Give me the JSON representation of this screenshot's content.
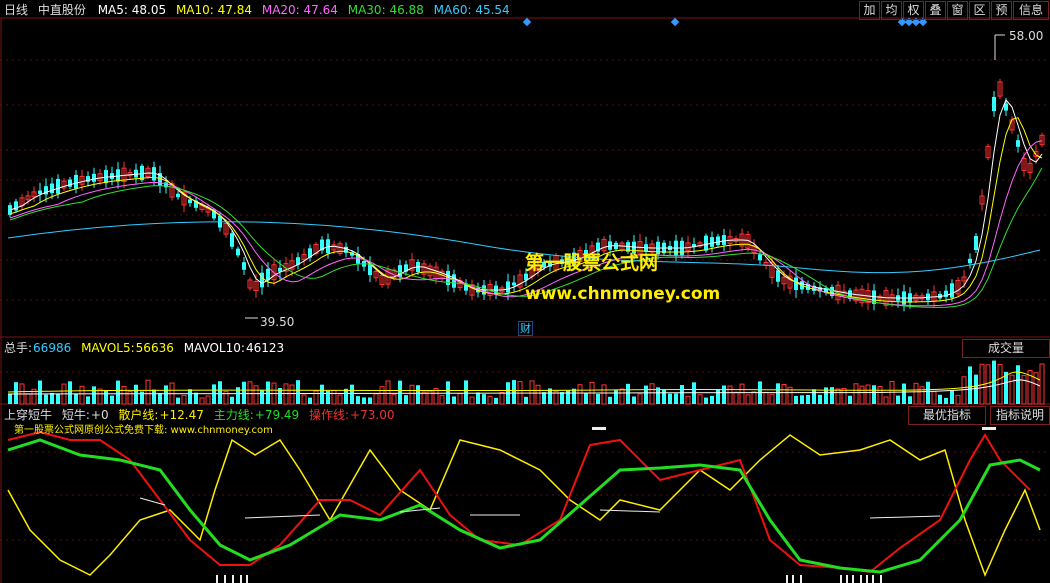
{
  "header": {
    "period": "日线",
    "stock": "中直股份",
    "ma": [
      {
        "label": "MA5:",
        "value": "48.05",
        "color": "#ffffff"
      },
      {
        "label": "MA10:",
        "value": "47.84",
        "color": "#ffff00"
      },
      {
        "label": "MA20:",
        "value": "47.64",
        "color": "#ff66ff"
      },
      {
        "label": "MA30:",
        "value": "46.88",
        "color": "#33dd33"
      },
      {
        "label": "MA60:",
        "value": "45.54",
        "color": "#33ccff"
      }
    ]
  },
  "toolbar": {
    "items": [
      "加",
      "均",
      "权",
      "叠",
      "窗",
      "区",
      "预"
    ],
    "info": "信息"
  },
  "price": {
    "high_label": "58.00",
    "low_label": "39.50",
    "fin_marker": "财"
  },
  "volume": {
    "total_label": "总手:",
    "total_value": "66986",
    "mavol5_label": "MAVOL5:",
    "mavol5_value": "56636",
    "mavol10_label": "MAVOL10:",
    "mavol10_value": "46123",
    "button": "成交量"
  },
  "indicator": {
    "name": "上穿短牛",
    "short_label": "短牛:",
    "short_value": "+0",
    "retail_label": "散户线:",
    "retail_value": "+12.47",
    "main_label": "主力线:",
    "main_value": "+79.49",
    "op_label": "操作线:",
    "op_value": "+73.00",
    "btn_best": "最优指标",
    "btn_explain": "指标说明",
    "banner": "第一股票公式网原创公式免费下载: www.chnmoney.com"
  },
  "watermark": {
    "line1": "第一股票公式网",
    "line2": "www.chnmoney.com"
  },
  "colors": {
    "up": "#ff3333",
    "down": "#33ffff",
    "grid": "#7a1515",
    "main": "#22dd22",
    "op": "#ee1111",
    "retail": "#ffee00"
  }
}
